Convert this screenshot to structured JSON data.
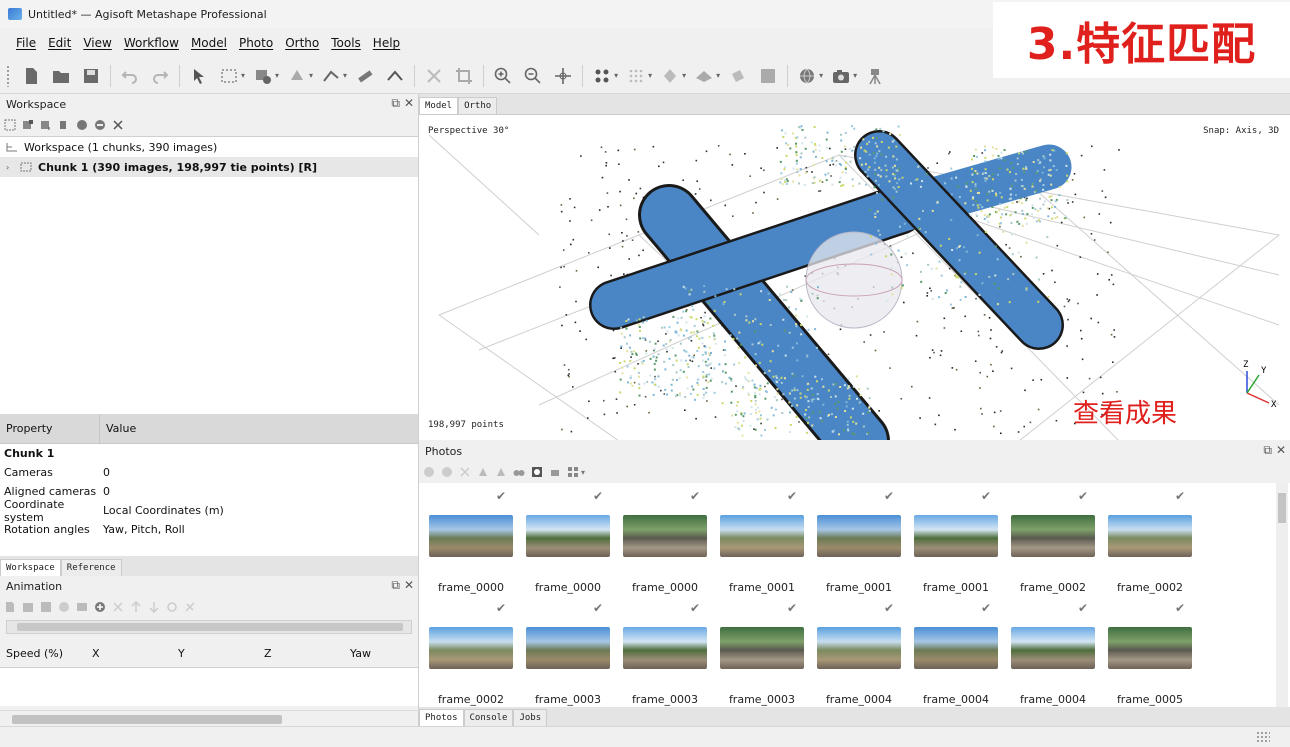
{
  "window": {
    "title": "Untitled* — Agisoft Metashape Professional",
    "controls": [
      "—",
      "☐",
      "✕"
    ]
  },
  "overlay": {
    "heading": "3.特征匹配",
    "result_note": "查看成果"
  },
  "menu": [
    "File",
    "Edit",
    "View",
    "Workflow",
    "Model",
    "Photo",
    "Ortho",
    "Tools",
    "Help"
  ],
  "toolbar": {
    "icons": [
      "new-icon",
      "open-icon",
      "save-icon",
      "undo-icon",
      "redo-icon",
      "navigate-icon",
      "rect-select-icon",
      "lasso-icon",
      "brush-icon",
      "ruler-icon",
      "polygon-icon",
      "delete-icon",
      "crop-icon",
      "zoom-in-icon",
      "zoom-out-icon",
      "move-icon",
      "points-icon",
      "grid-icon",
      "shading-icon",
      "surface-icon",
      "texture-icon",
      "image-icon",
      "globe-icon",
      "camera-icon",
      "tripod-icon",
      "region-icon",
      "transform-icon",
      "scale-icon",
      "markers-icon"
    ]
  },
  "workspace": {
    "title": "Workspace",
    "tree": {
      "root": "Workspace (1 chunks, 390 images)",
      "chunk": "Chunk 1 (390 images, 198,997 tie points) [R]"
    }
  },
  "properties": {
    "headers": [
      "Property",
      "Value"
    ],
    "title": "Chunk 1",
    "rows": [
      {
        "key": "Cameras",
        "value": "0"
      },
      {
        "key": "Aligned cameras",
        "value": "0"
      },
      {
        "key": "Coordinate system",
        "value": "Local Coordinates (m)"
      },
      {
        "key": "Rotation angles",
        "value": "Yaw, Pitch, Roll"
      }
    ]
  },
  "left_tabs": [
    "Workspace",
    "Reference"
  ],
  "animation": {
    "title": "Animation",
    "columns": [
      "Speed (%)",
      "X",
      "Y",
      "Z",
      "Yaw"
    ]
  },
  "model": {
    "tabs": [
      "Model",
      "Ortho"
    ],
    "projection": "Perspective 30°",
    "snap": "Snap: Axis, 3D",
    "points": "198,997 points",
    "axes": {
      "x": "X",
      "y": "Y",
      "z": "Z"
    }
  },
  "photos": {
    "title": "Photos",
    "items": [
      "frame_0000",
      "frame_0000",
      "frame_0000",
      "frame_0001",
      "frame_0001",
      "frame_0001",
      "frame_0002",
      "frame_0002",
      "frame_0002",
      "frame_0003",
      "frame_0003",
      "frame_0003",
      "frame_0004",
      "frame_0004",
      "frame_0004",
      "frame_0005"
    ]
  },
  "bottom_tabs": [
    "Photos",
    "Console",
    "Jobs"
  ],
  "colors": {
    "overlay_red": "#e0201c",
    "tube_blue": "#4a86c5",
    "selection_gray": "#e7e7e7"
  }
}
